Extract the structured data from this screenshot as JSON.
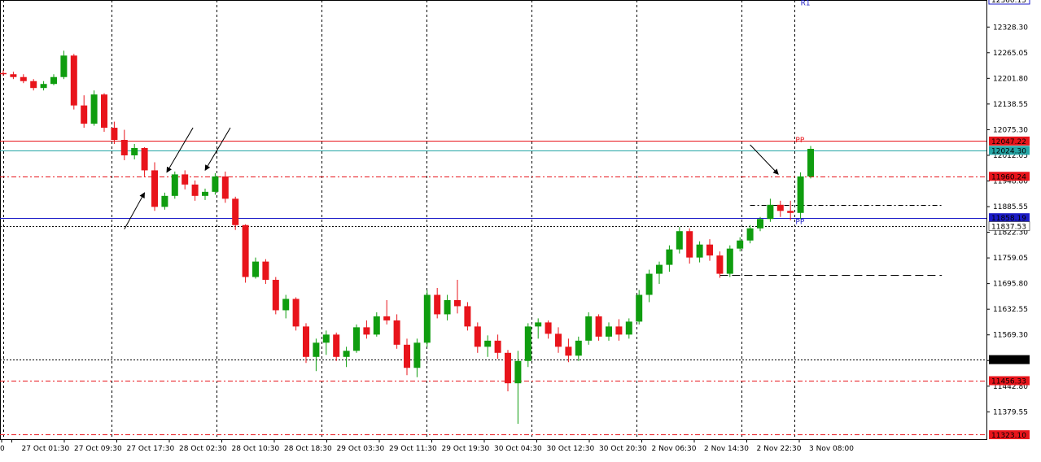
{
  "chart_data": {
    "type": "candlestick",
    "title": "",
    "xlabel": "",
    "ylabel": "",
    "ylim": [
      11312,
      12395
    ],
    "grid": true,
    "colors": {
      "bull": "#0f9d0f",
      "bear": "#e8141b",
      "grid": "#000000",
      "pp_red": "#e8141b",
      "pp_blue": "#1c1cc8",
      "teal": "#26a6a6",
      "axis": "#000000"
    },
    "y_ticks": [
      "12328.30",
      "12265.05",
      "12201.80",
      "12138.55",
      "12075.30",
      "12012.05",
      "11948.80",
      "11885.55",
      "11822.30",
      "11759.05",
      "11695.80",
      "11632.55",
      "11569.30",
      "11506.05",
      "11442.80",
      "11379.55"
    ],
    "x_ticks": [
      "0",
      "27 Oct 01:30",
      "27 Oct 09:30",
      "27 Oct 17:30",
      "28 Oct 02:30",
      "28 Oct 10:30",
      "28 Oct 18:30",
      "29 Oct 03:30",
      "29 Oct 11:30",
      "29 Oct 19:30",
      "30 Oct 04:30",
      "30 Oct 12:30",
      "30 Oct 20:30",
      "2 Nov 06:30",
      "2 Nov 14:30",
      "2 Nov 22:30",
      "3 Nov 08:00"
    ],
    "vertical_grid_after_tick": [
      2,
      4,
      6,
      8,
      10,
      12,
      14,
      15
    ],
    "horizontal_lines": [
      {
        "value": 12047.22,
        "label": "12047.22",
        "style": "solid",
        "color": "#e8141b",
        "badge_bg": "#e8141b",
        "badge_fg": "#ffffff"
      },
      {
        "value": 12024.3,
        "label": "12024.30",
        "style": "solid",
        "color": "#26a6a6",
        "badge_bg": "#26a6a6",
        "badge_fg": "#ffffff"
      },
      {
        "value": 11960.24,
        "label": "11960.24",
        "style": "dashdot",
        "color": "#e8141b",
        "badge_bg": "#e8141b",
        "badge_fg": "#ffffff"
      },
      {
        "value": 11858.19,
        "label": "11858.19",
        "style": "solid",
        "color": "#1c1cc8",
        "badge_bg": "#1c1cc8",
        "badge_fg": "#ffffff"
      },
      {
        "value": 11837.53,
        "label": "11837.53",
        "style": "dotted",
        "color": "#000000",
        "badge_bg": "#ffffff",
        "badge_fg": "#000000"
      },
      {
        "value": 11508.29,
        "label": "11508.29",
        "style": "dotted",
        "color": "#000000",
        "badge_bg": "#000000",
        "badge_fg": "#ffffff"
      },
      {
        "value": 11456.33,
        "label": "11456.33",
        "style": "dashdot",
        "color": "#e8141b",
        "badge_bg": "#e8141b",
        "badge_fg": "#ffffff"
      },
      {
        "value": 11323.1,
        "label": "11323.10",
        "style": "dashdot",
        "color": "#e8141b",
        "badge_bg": "#e8141b",
        "badge_fg": "#ffffff"
      }
    ],
    "top_badge": {
      "label": "12360.15",
      "color": "#1c1cc8"
    },
    "segment_lines": [
      {
        "value": 11890,
        "style": "dashdot",
        "from_index": 74,
        "to_index": 93
      },
      {
        "value": 11718,
        "style": "dashed",
        "from_index": 71,
        "to_index": 93
      }
    ],
    "annotations": [
      {
        "text": "R1",
        "color": "#1c1cc8",
        "index": 79,
        "value": 12390
      },
      {
        "text": "PP",
        "color": "#e8141b",
        "index": 78.5,
        "value": 12052
      },
      {
        "text": "PP",
        "color": "#1c1cc8",
        "index": 78.5,
        "value": 11850
      }
    ],
    "arrows": [
      {
        "from": [
          12,
          11830
        ],
        "to": [
          14,
          11920
        ]
      },
      {
        "from": [
          18.8,
          12080
        ],
        "to": [
          16.2,
          11970
        ]
      },
      {
        "from": [
          22.5,
          12080
        ],
        "to": [
          20,
          11975
        ]
      },
      {
        "from": [
          74,
          12038
        ],
        "to": [
          76.8,
          11965
        ]
      }
    ],
    "candles": [
      [
        12215,
        12222,
        12208,
        12212
      ],
      [
        12212,
        12218,
        12200,
        12205
      ],
      [
        12205,
        12212,
        12190,
        12195
      ],
      [
        12195,
        12200,
        12172,
        12178
      ],
      [
        12178,
        12195,
        12172,
        12188
      ],
      [
        12188,
        12212,
        12185,
        12205
      ],
      [
        12205,
        12270,
        12200,
        12258
      ],
      [
        12258,
        12262,
        12125,
        12135
      ],
      [
        12135,
        12160,
        12080,
        12090
      ],
      [
        12090,
        12172,
        12085,
        12162
      ],
      [
        12162,
        12165,
        12070,
        12080
      ],
      [
        12080,
        12095,
        12040,
        12050
      ],
      [
        12050,
        12075,
        12000,
        12012
      ],
      [
        12012,
        12040,
        12002,
        12030
      ],
      [
        12030,
        12032,
        11960,
        11975
      ],
      [
        11975,
        11995,
        11875,
        11885
      ],
      [
        11885,
        11920,
        11878,
        11912
      ],
      [
        11912,
        11972,
        11905,
        11965
      ],
      [
        11965,
        11975,
        11928,
        11940
      ],
      [
        11940,
        11950,
        11900,
        11912
      ],
      [
        11912,
        11930,
        11902,
        11922
      ],
      [
        11922,
        11968,
        11915,
        11960
      ],
      [
        11960,
        11972,
        11895,
        11905
      ],
      [
        11905,
        11910,
        11828,
        11840
      ],
      [
        11840,
        11842,
        11698,
        11712
      ],
      [
        11712,
        11760,
        11708,
        11750
      ],
      [
        11750,
        11756,
        11695,
        11705
      ],
      [
        11705,
        11712,
        11620,
        11630
      ],
      [
        11630,
        11668,
        11610,
        11658
      ],
      [
        11658,
        11662,
        11580,
        11590
      ],
      [
        11590,
        11598,
        11500,
        11515
      ],
      [
        11515,
        11560,
        11480,
        11550
      ],
      [
        11550,
        11580,
        11520,
        11570
      ],
      [
        11570,
        11575,
        11505,
        11515
      ],
      [
        11515,
        11540,
        11490,
        11530
      ],
      [
        11530,
        11595,
        11525,
        11588
      ],
      [
        11588,
        11605,
        11560,
        11570
      ],
      [
        11570,
        11625,
        11565,
        11615
      ],
      [
        11615,
        11655,
        11595,
        11605
      ],
      [
        11605,
        11620,
        11535,
        11545
      ],
      [
        11545,
        11560,
        11470,
        11488
      ],
      [
        11488,
        11560,
        11465,
        11550
      ],
      [
        11550,
        11680,
        11540,
        11668
      ],
      [
        11668,
        11685,
        11610,
        11620
      ],
      [
        11620,
        11668,
        11605,
        11655
      ],
      [
        11655,
        11705,
        11622,
        11640
      ],
      [
        11640,
        11650,
        11580,
        11590
      ],
      [
        11590,
        11600,
        11525,
        11540
      ],
      [
        11540,
        11568,
        11515,
        11555
      ],
      [
        11555,
        11570,
        11510,
        11525
      ],
      [
        11525,
        11532,
        11430,
        11450
      ],
      [
        11450,
        11530,
        11350,
        11505
      ],
      [
        11505,
        11598,
        11490,
        11590
      ],
      [
        11590,
        11610,
        11560,
        11600
      ],
      [
        11600,
        11605,
        11560,
        11572
      ],
      [
        11572,
        11588,
        11525,
        11540
      ],
      [
        11540,
        11560,
        11502,
        11518
      ],
      [
        11518,
        11565,
        11505,
        11555
      ],
      [
        11555,
        11625,
        11545,
        11615
      ],
      [
        11615,
        11620,
        11555,
        11565
      ],
      [
        11565,
        11600,
        11555,
        11590
      ],
      [
        11590,
        11608,
        11555,
        11570
      ],
      [
        11570,
        11610,
        11560,
        11602
      ],
      [
        11602,
        11680,
        11595,
        11668
      ],
      [
        11668,
        11730,
        11650,
        11720
      ],
      [
        11720,
        11750,
        11695,
        11742
      ],
      [
        11742,
        11790,
        11725,
        11780
      ],
      [
        11780,
        11835,
        11770,
        11825
      ],
      [
        11825,
        11832,
        11745,
        11760
      ],
      [
        11760,
        11800,
        11748,
        11792
      ],
      [
        11792,
        11805,
        11752,
        11765
      ],
      [
        11765,
        11775,
        11710,
        11720
      ],
      [
        11720,
        11790,
        11712,
        11782
      ],
      [
        11782,
        11810,
        11775,
        11802
      ],
      [
        11802,
        11840,
        11795,
        11832
      ],
      [
        11832,
        11860,
        11825,
        11855
      ],
      [
        11855,
        11905,
        11848,
        11890
      ],
      [
        11890,
        11900,
        11860,
        11875
      ],
      [
        11875,
        11900,
        11852,
        11870
      ],
      [
        11870,
        11970,
        11855,
        11960
      ],
      [
        11960,
        12035,
        11955,
        12028
      ]
    ]
  }
}
